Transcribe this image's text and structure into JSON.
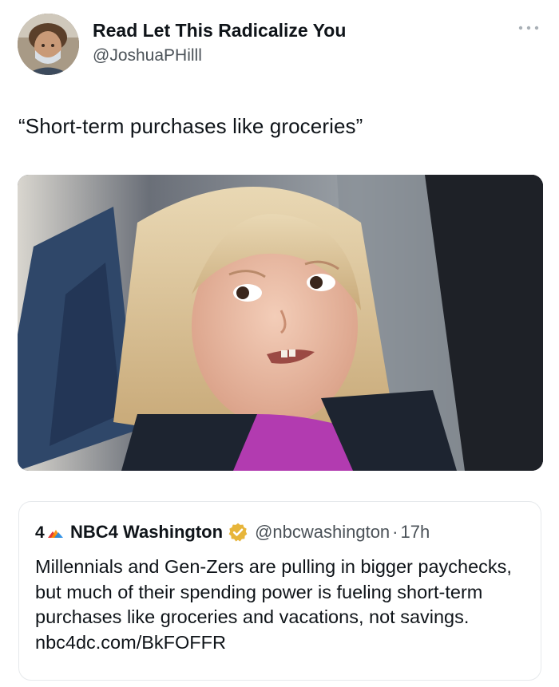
{
  "tweet": {
    "display_name": "Read Let This Radicalize You",
    "handle": "@JoshuaPHilll",
    "text": "“Short-term purchases like groceries”"
  },
  "quoted": {
    "name": "NBC4 Washington",
    "handle": "@nbcwashington",
    "separator": "·",
    "time": "17h",
    "text": "Millennials and Gen-Zers are pulling in bigger paychecks, but much of their spending power is fueling short-term purchases like groceries and vacations, not savings. nbc4dc.com/BkFOFFR"
  },
  "colors": {
    "gold_badge": "#e7b53a",
    "secondary_text": "#4b5258",
    "shirt": "#b23bb0"
  },
  "icons": [
    "more-icon",
    "nbc4-logo",
    "verified-badge-icon"
  ]
}
